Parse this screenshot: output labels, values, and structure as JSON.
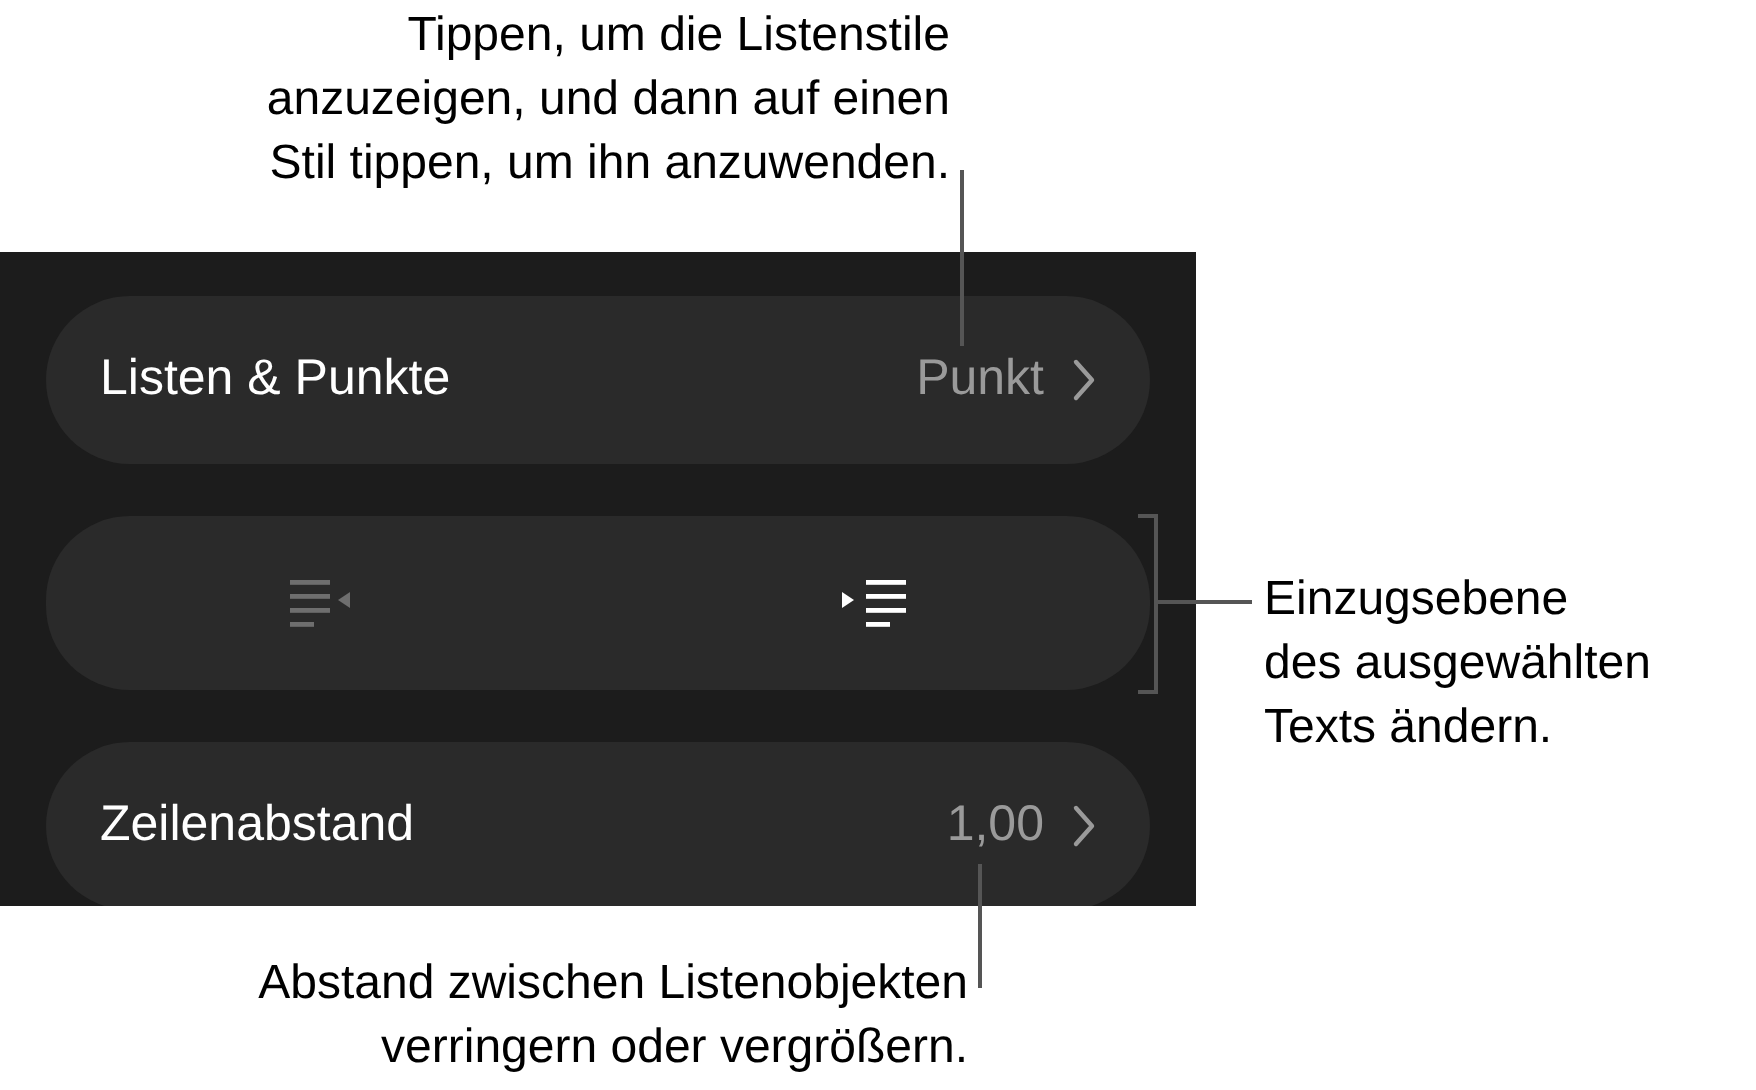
{
  "callouts": [
    {
      "kind": "top",
      "lines": [
        "Tippen, um die Listenstile",
        "anzuzeigen, und dann auf einen",
        "Stil tippen, um ihn anzuwenden."
      ]
    },
    {
      "kind": "right",
      "lines": [
        "Einzugsebene",
        "des ausgewählten",
        "Texts ändern."
      ]
    },
    {
      "kind": "bottom",
      "lines": [
        "Abstand zwischen Listenobjekten",
        "verringern oder vergrößern."
      ]
    }
  ],
  "rows": [
    {
      "kind": "value",
      "label": "Listen & Punkte",
      "value": "Punkt"
    },
    {
      "kind": "indent",
      "buttons": [
        {
          "kind": "outdent",
          "disabled": true
        },
        {
          "kind": "indent",
          "disabled": false
        }
      ]
    },
    {
      "kind": "value",
      "label": "Zeilenabstand",
      "value": "1,00"
    }
  ]
}
